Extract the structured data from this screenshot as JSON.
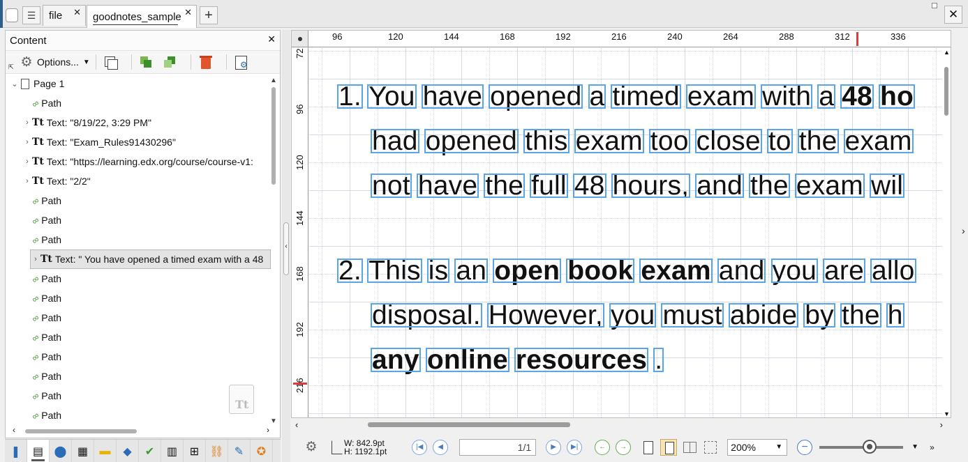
{
  "tabs": {
    "file_label": "file",
    "active_label": "goodnotes_sample",
    "close_glyph": "✕",
    "add_glyph": "+"
  },
  "panel": {
    "title": "Content",
    "options_label": "Options...",
    "tree": [
      {
        "kind": "page",
        "label": "Page 1",
        "expanded": true
      },
      {
        "kind": "path",
        "label": "Path"
      },
      {
        "kind": "text",
        "label": "Text: \"8/19/22, 3:29 PM\""
      },
      {
        "kind": "text",
        "label": "Text: \"Exam_Rules91430296\""
      },
      {
        "kind": "text",
        "label": "Text: \"https://learning.edx.org/course/course-v1:"
      },
      {
        "kind": "text",
        "label": "Text: \"2/2\""
      },
      {
        "kind": "path",
        "label": "Path"
      },
      {
        "kind": "path",
        "label": "Path"
      },
      {
        "kind": "path",
        "label": "Path"
      },
      {
        "kind": "text",
        "label": "Text: \" You have opened a timed exam with a 48",
        "selected": true
      },
      {
        "kind": "path",
        "label": "Path"
      },
      {
        "kind": "path",
        "label": "Path"
      },
      {
        "kind": "path",
        "label": "Path"
      },
      {
        "kind": "path",
        "label": "Path"
      },
      {
        "kind": "path",
        "label": "Path"
      },
      {
        "kind": "path",
        "label": "Path"
      },
      {
        "kind": "path",
        "label": "Path"
      },
      {
        "kind": "path",
        "label": "Path"
      }
    ],
    "text_icon_glyph": "Tt"
  },
  "ruler": {
    "x_ticks": [
      "96",
      "120",
      "144",
      "168",
      "192",
      "216",
      "240",
      "264",
      "288",
      "312",
      "336"
    ],
    "y_ticks": [
      "72",
      "96",
      "120",
      "144",
      "168",
      "192",
      "216"
    ]
  },
  "document": {
    "line1": {
      "num": "1.",
      "pre": "You have opened a timed exam with a ",
      "bold": "48 ho"
    },
    "line2": {
      "text": "had opened this exam too close to the exam"
    },
    "line3": {
      "text": "not have the full 48 hours, and the exam wil"
    },
    "line4": {
      "num": "2.",
      "pre": "This is an ",
      "bold": "open book exam",
      "post": " and you are allo"
    },
    "line5": {
      "text": "disposal. However, you must abide by the h"
    },
    "line6": {
      "bold": "any online resources",
      "post": " ."
    }
  },
  "status": {
    "width_label": "W:  842.9pt",
    "height_label": "H: 1192.1pt",
    "page_field": "1/1",
    "zoom": "200%"
  },
  "colors": {
    "word_box": "#5aa4e8",
    "ruler_marker": "#e03a3a"
  }
}
